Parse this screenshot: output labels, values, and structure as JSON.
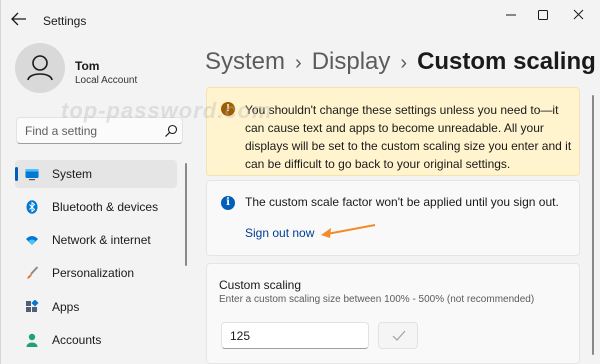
{
  "window": {
    "title": "Settings"
  },
  "user": {
    "name": "Tom",
    "account_type": "Local Account"
  },
  "search": {
    "placeholder": "Find a setting"
  },
  "sidebar": {
    "items": [
      {
        "label": "System",
        "icon": "monitor-icon",
        "selected": true
      },
      {
        "label": "Bluetooth & devices",
        "icon": "bluetooth-icon",
        "selected": false
      },
      {
        "label": "Network & internet",
        "icon": "wifi-icon",
        "selected": false
      },
      {
        "label": "Personalization",
        "icon": "brush-icon",
        "selected": false
      },
      {
        "label": "Apps",
        "icon": "apps-icon",
        "selected": false
      },
      {
        "label": "Accounts",
        "icon": "person-icon",
        "selected": false
      }
    ]
  },
  "breadcrumb": {
    "parts": [
      "System",
      "Display"
    ],
    "separator": "›",
    "current": "Custom scaling"
  },
  "warning": {
    "text": "You shouldn't change these settings unless you need to—it can cause text and apps to become unreadable. All your displays will be set to the custom scaling size you enter and it can be difficult to go back to your original settings.",
    "icon_glyph": "!"
  },
  "info": {
    "text": "The custom scale factor won't be applied until you sign out.",
    "link": "Sign out now",
    "icon_glyph": "i"
  },
  "custom_scaling": {
    "title": "Custom scaling",
    "description": "Enter a custom scaling size between 100% - 500% (not recommended)",
    "value": "125"
  },
  "watermark": "top-password.com",
  "colors": {
    "accent": "#005fb8",
    "warning_bg": "#fff4ce",
    "warning_icon": "#9d5d00",
    "arrow": "#f28c28",
    "link": "#003e92"
  }
}
